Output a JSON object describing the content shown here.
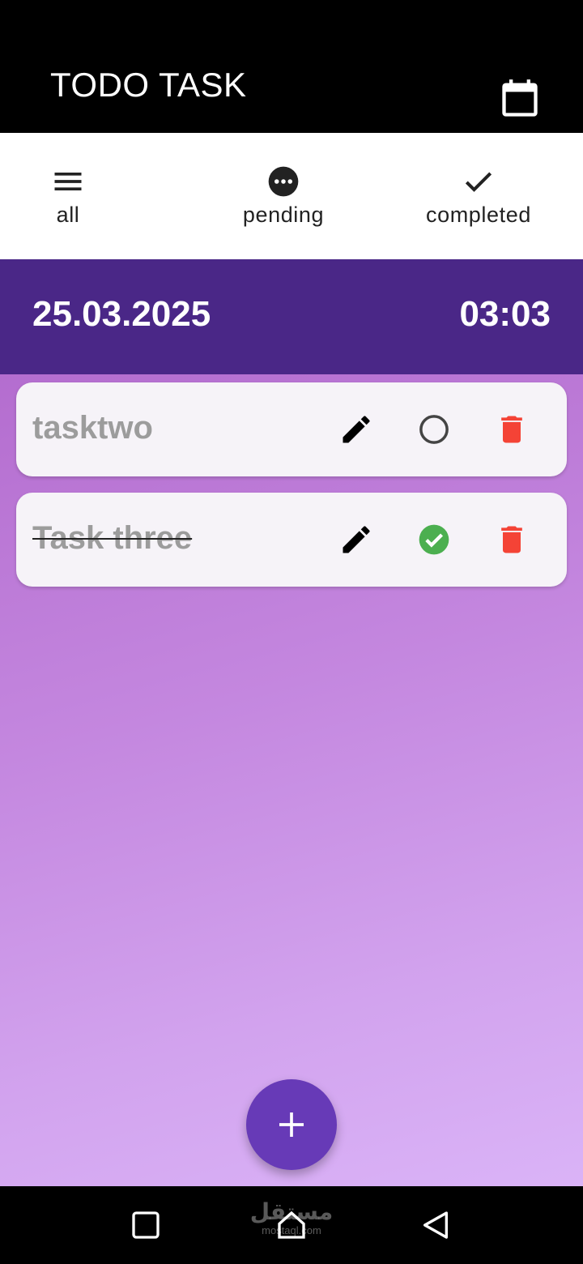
{
  "app": {
    "title": "TODO TASK"
  },
  "tabs": [
    {
      "label": "all",
      "icon": "menu-icon"
    },
    {
      "label": "pending",
      "icon": "more-horizontal-circle-icon"
    },
    {
      "label": "completed",
      "icon": "check-icon"
    }
  ],
  "header": {
    "date": "25.03.2025",
    "time": "03:03"
  },
  "tasks": [
    {
      "title": "tasktwo",
      "completed": false
    },
    {
      "title": "Task three",
      "completed": true
    }
  ],
  "watermark": {
    "arabic": "مستقل",
    "latin": "mostaql.com"
  },
  "colors": {
    "appbar": "#000000",
    "date_bar": "#4a2787",
    "fab": "#673ab7",
    "delete": "#f44336",
    "completed_check": "#4caf50",
    "task_text": "#9c9c9c"
  }
}
